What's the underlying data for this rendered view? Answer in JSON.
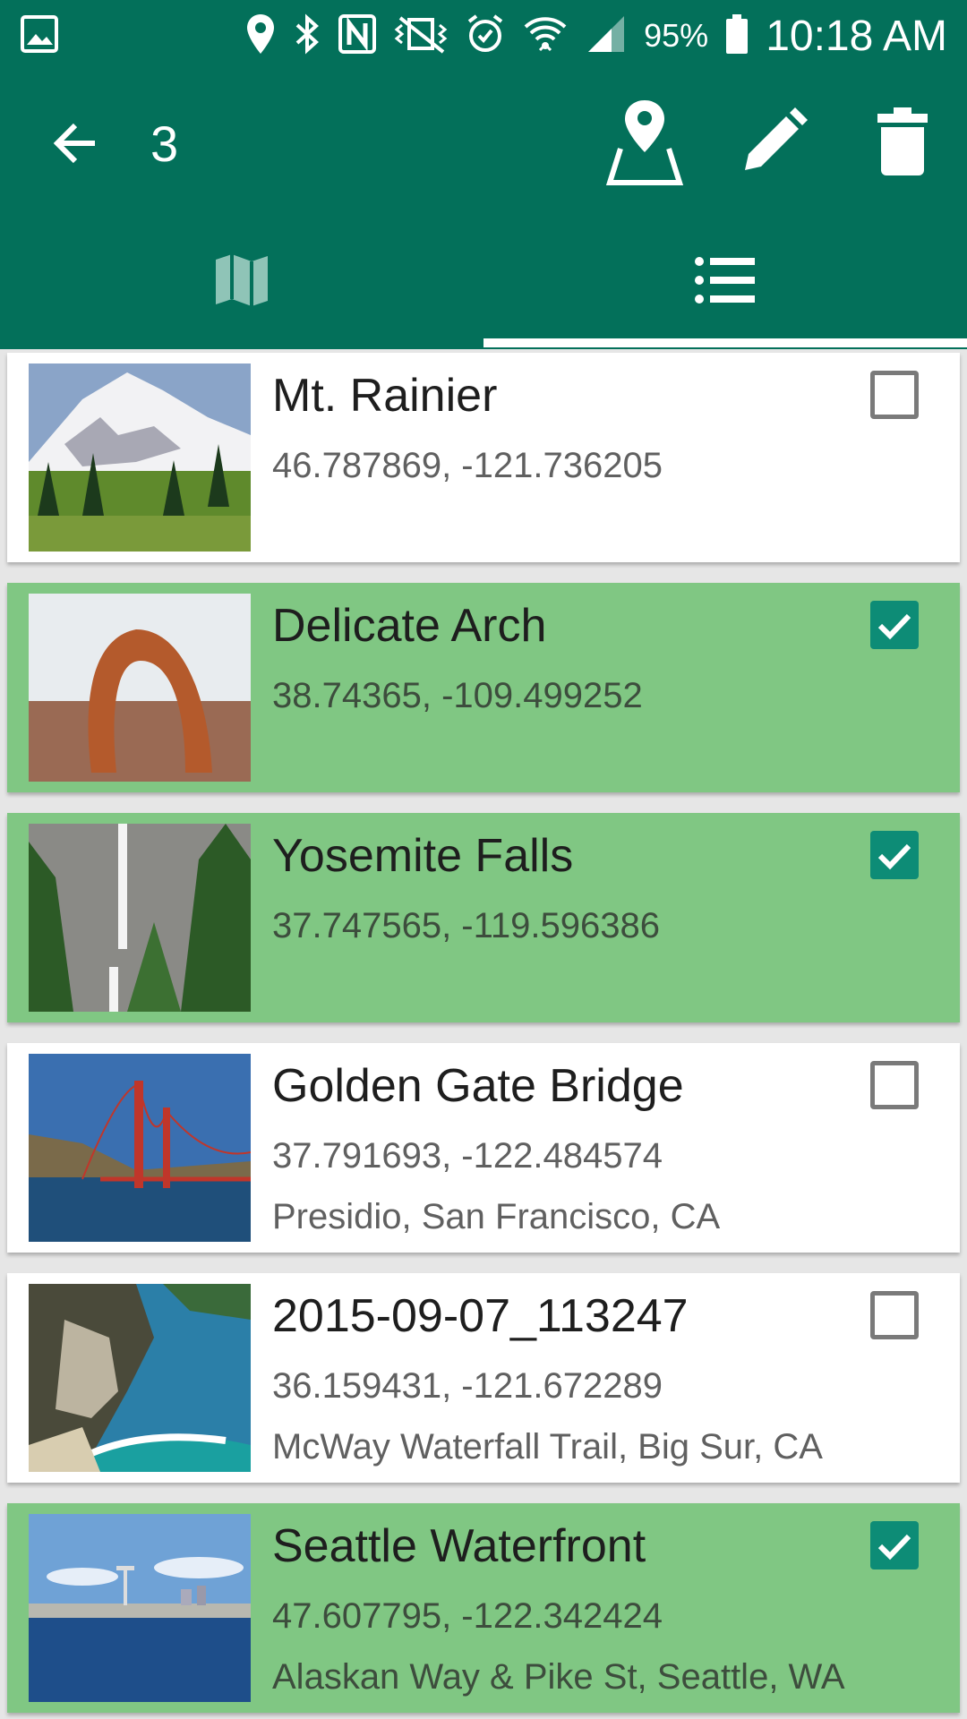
{
  "status_bar": {
    "battery_percent": "95%",
    "time": "10:18 AM",
    "icons": [
      "gallery-icon",
      "location-icon",
      "bluetooth-icon",
      "nfc-icon",
      "vibrate-icon",
      "alarm-icon",
      "wifi-icon",
      "signal-icon",
      "battery-icon"
    ]
  },
  "app_bar": {
    "selected_count": "3",
    "actions": [
      "map-pin-icon",
      "edit-icon",
      "delete-icon"
    ]
  },
  "tabs": [
    {
      "name": "map",
      "icon": "map-icon",
      "selected": false
    },
    {
      "name": "list",
      "icon": "list-icon",
      "selected": true
    }
  ],
  "colors": {
    "primary": "#03705a",
    "selected_card": "#80c783",
    "checkbox_checked": "#0d8c76"
  },
  "places": [
    {
      "title": "Mt. Rainier",
      "coords": "46.787869, -121.736205",
      "address": "",
      "checked": false
    },
    {
      "title": "Delicate Arch",
      "coords": "38.74365, -109.499252",
      "address": "",
      "checked": true
    },
    {
      "title": "Yosemite Falls",
      "coords": "37.747565, -119.596386",
      "address": "",
      "checked": true
    },
    {
      "title": "Golden Gate Bridge",
      "coords": "37.791693, -122.484574",
      "address": "Presidio, San Francisco, CA",
      "checked": false
    },
    {
      "title": "2015-09-07_113247",
      "coords": "36.159431, -121.672289",
      "address": "McWay Waterfall Trail, Big Sur, CA",
      "checked": false
    },
    {
      "title": "Seattle Waterfront",
      "coords": "47.607795, -122.342424",
      "address": "Alaskan Way & Pike St, Seattle, WA",
      "checked": true
    }
  ]
}
